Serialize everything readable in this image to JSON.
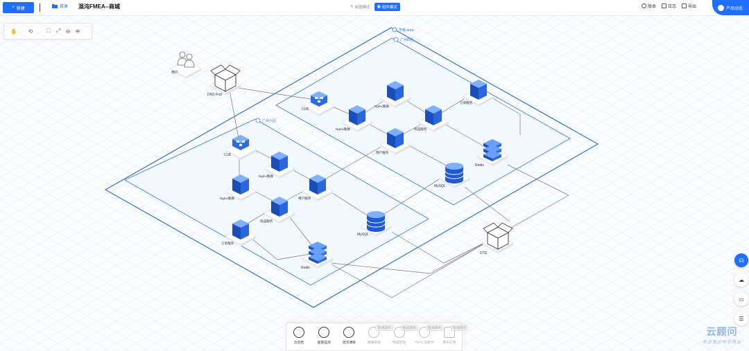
{
  "topbar": {
    "new_label": "新建",
    "directory_label": "目录",
    "title": "混沌FMEA--商城",
    "mode_draw": "绘图模式",
    "mode_component": "组件模式",
    "version_label": "版本",
    "log_label": "日志",
    "export_label": "导出",
    "product_label": "产品动态"
  },
  "diagram": {
    "region_label": "华南 area",
    "zone_top_label": "广州四区",
    "zone_bottom_label": "广州六区",
    "user_label": "用户",
    "dns_label": "DNS Pod",
    "dts_label": "DTS",
    "zone_top": {
      "clb": "CLB",
      "nginx1": "Nginx集群",
      "nginx2": "Nginx集群",
      "user_service": "用户服务",
      "product_service": "商品服务",
      "order_service": "订单服务",
      "redis": "Redis",
      "mysql": "MySQL"
    },
    "zone_bottom": {
      "clb": "CLB",
      "nginx1": "Nginx集群",
      "nginx2": "Nginx集群",
      "user_service": "用户服务",
      "product_service": "商品服务",
      "order_service": "订单服务",
      "redis": "Redis",
      "mysql": "MySQL"
    }
  },
  "dock": {
    "items": [
      {
        "label": "云巡检",
        "badge": ""
      },
      {
        "label": "容量监测",
        "badge": ""
      },
      {
        "label": "混沌演练",
        "badge": ""
      },
      {
        "label": "健康看板",
        "badge": "敬请期待"
      },
      {
        "label": "预案管理",
        "badge": "敬请期待"
      },
      {
        "label": "TBTC 云助手",
        "badge": "敬请期待"
      },
      {
        "label": "更多应用",
        "badge": "敬请期待"
      }
    ]
  },
  "watermark": {
    "line1": "云顾问",
    "line2": "帮您更好地使用云"
  },
  "colors": {
    "accent": "#1f6fff",
    "node_blue": "#2563d8",
    "zone_fill": "#f3f8ff",
    "zone_line": "#3a7fd0"
  }
}
